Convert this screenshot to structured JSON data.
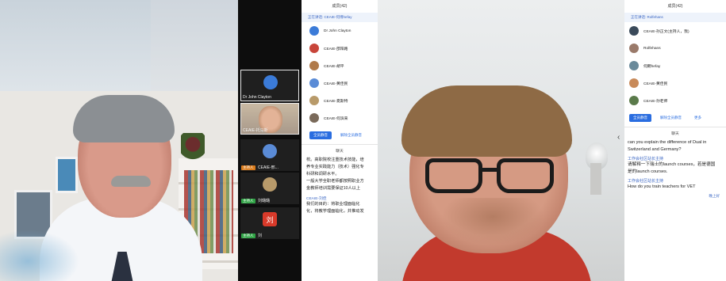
{
  "left_video": {
    "label": "presenter"
  },
  "video_column": {
    "tiles": [
      {
        "name": "Dr John Clayton",
        "badge": "",
        "avatar_color": "#3b7bd8",
        "avatar_glyph": "",
        "active": true
      },
      {
        "name": "CEAIE-托马斯",
        "badge": "",
        "avatar_color": "",
        "avatar_glyph": "",
        "active": true,
        "photo": true
      },
      {
        "name": "CEAIE-邢...",
        "badge": "主持人",
        "badge_color": "#d97a1a",
        "avatar_color": "#5a8bd6",
        "avatar_glyph": "",
        "active": false
      },
      {
        "name": "刘璐璐",
        "badge": "主持人",
        "badge_color": "#2fa345",
        "avatar_color": "#b89a6a",
        "avatar_glyph": "",
        "active": false
      },
      {
        "name": "刘",
        "badge": "主持人",
        "badge_color": "#2fa345",
        "avatar_color": "#d93a2a",
        "avatar_glyph": "刘",
        "active": false
      }
    ]
  },
  "panel1": {
    "header": "成员(42)",
    "tab": "正在讲话: CEAIE-何博hefay",
    "members": [
      {
        "name": "Dr John Clayton",
        "avatar_color": "#3b7bd8"
      },
      {
        "name": "CEAIE-邵阳路",
        "avatar_color": "#c8453a"
      },
      {
        "name": "CEAIE-胡平",
        "avatar_color": "#b07a4a"
      },
      {
        "name": "CEAIE-黄佳民",
        "avatar_color": "#5a8bd6"
      },
      {
        "name": "CEAIE-夏斯特",
        "avatar_color": "#b89a6a"
      },
      {
        "name": "CEAIE-何滨来",
        "avatar_color": "#7a6a5a"
      }
    ],
    "btn_primary": "全员静音",
    "btn_ghost": "解除全员静音",
    "chat_header": "聊天",
    "messages": [
      "校。高职院校注重技术技能，培",
      "养专业实践能力（技术）强化专",
      "科研和调研水平。",
      "一般大学全职老师都按照职业方",
      "金教师培训需要保证10人以上"
    ],
    "sender": "CEAIE-刘佳",
    "messages2": [
      "我们的目的：将职业理面临化",
      "化，将教学理面临化，并推动发"
    ]
  },
  "right_video": {
    "label": "participant"
  },
  "panel2": {
    "header": "成员(42)",
    "tab": "正在讲话: Rolfehans",
    "members": [
      {
        "name": "CEAIE-孙正文(主持人，我)",
        "avatar_color": "#3a4a5a"
      },
      {
        "name": "Rolfehans",
        "avatar_color": "#9a7a6a"
      },
      {
        "name": "何朗hefay",
        "avatar_color": "#6a8a9a"
      },
      {
        "name": "CEAIE-黄佳民",
        "avatar_color": "#c88a5a"
      },
      {
        "name": "CEAIE-孙老师",
        "avatar_color": "#5a7a4a"
      }
    ],
    "btn_primary": "全员静音",
    "btn_ghost": "解除全员静音",
    "btn_more": "更多",
    "chat_header": "聊天",
    "messages": [
      "can you explain the difference of Dual in",
      "Switzerland and Germany?"
    ],
    "sender": "工作会社区站长主持",
    "messages2": [
      "请解释一下瑞士的launch courses，若是德国",
      "是的launch courses."
    ],
    "sender2": "工作会社区站长主持",
    "messages3": [
      "How do you train teachers for VET"
    ],
    "time": "晚上好"
  }
}
